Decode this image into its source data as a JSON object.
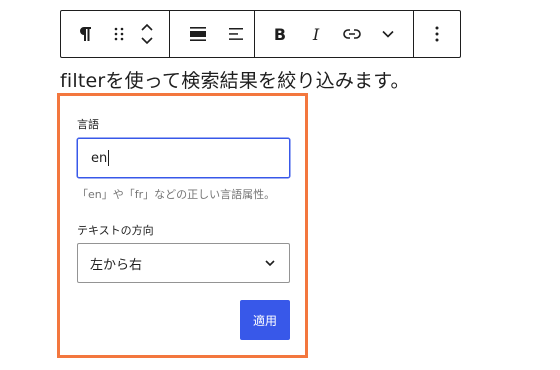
{
  "toolbar": {
    "paragraph_icon": "pilcrow-icon",
    "drag_icon": "drag-handle-icon",
    "move_icon": "move-up-down-icon",
    "align_icon": "align-icon",
    "text_align_icon": "text-align-left-icon",
    "bold_label": "B",
    "italic_label": "I",
    "link_icon": "link-icon",
    "more_icon": "chevron-down-icon",
    "options_icon": "more-vertical-icon"
  },
  "paragraph": {
    "text": "filterを使って検索結果を絞り込みます。"
  },
  "popover": {
    "accent_color": "#f3773e",
    "language_label": "言語",
    "language_value": "en",
    "language_help": "「en」や「fr」などの正しい言語属性。",
    "direction_label": "テキストの方向",
    "direction_value": "左から右",
    "apply_label": "適用",
    "apply_color": "#3858e9"
  }
}
